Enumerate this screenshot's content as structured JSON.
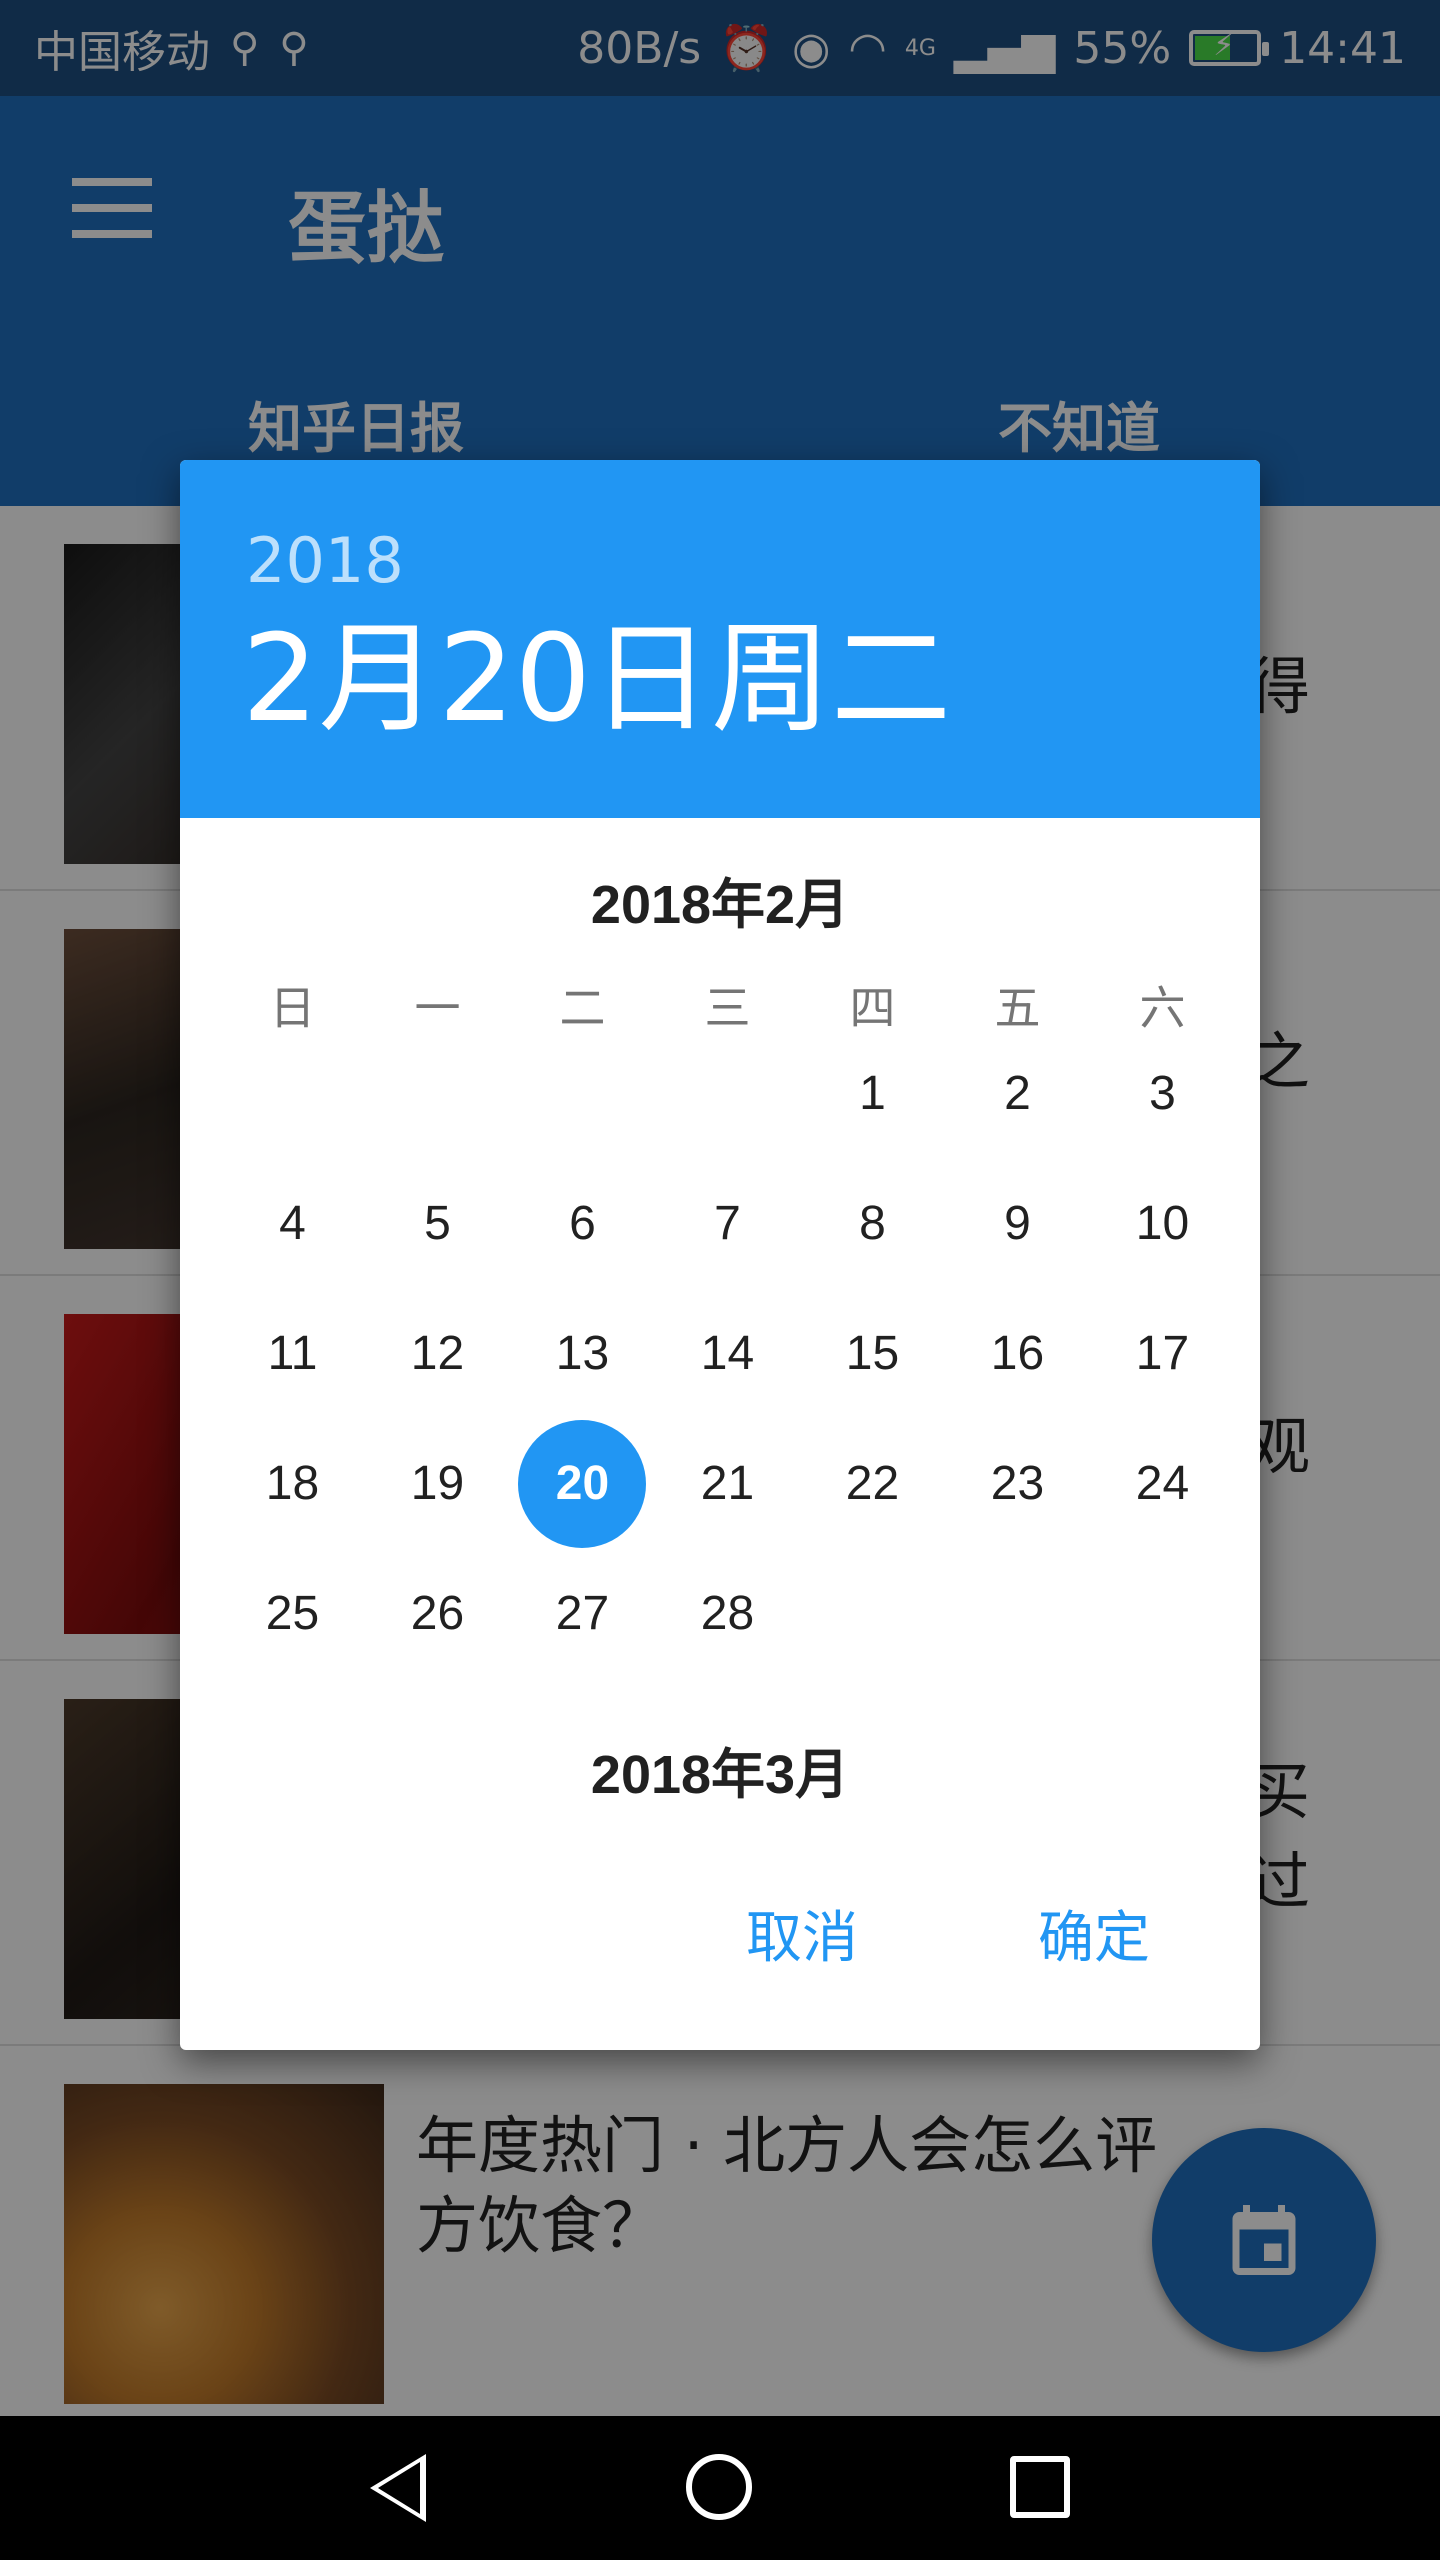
{
  "status_bar": {
    "carrier": "中国移动",
    "net_speed": "80B/s",
    "network": "4G",
    "battery": "55%",
    "time": "14:41"
  },
  "app_bar": {
    "title": "蛋挞",
    "tabs": [
      "知乎日报",
      "不知道"
    ]
  },
  "list": {
    "items": [
      {
        "visible_tail": "得"
      },
      {
        "visible_tail": "之"
      },
      {
        "visible_tail": "观"
      },
      {
        "visible_tail_1": "买",
        "visible_tail_2": "过"
      },
      {
        "title": "年度热门 · 北方人会怎么评方饮食？",
        "line1": "年度热门 · 北方人会怎么评",
        "line2": "方饮食？"
      }
    ]
  },
  "dialog": {
    "header_year": "2018",
    "header_date": "2月20日周二",
    "month_title": "2018年2月",
    "next_month_title": "2018年3月",
    "weekdays": [
      "日",
      "一",
      "二",
      "三",
      "四",
      "五",
      "六"
    ],
    "weeks": [
      [
        "",
        "",
        "",
        "",
        "1",
        "2",
        "3"
      ],
      [
        "4",
        "5",
        "6",
        "7",
        "8",
        "9",
        "10"
      ],
      [
        "11",
        "12",
        "13",
        "14",
        "15",
        "16",
        "17"
      ],
      [
        "18",
        "19",
        "20",
        "21",
        "22",
        "23",
        "24"
      ],
      [
        "25",
        "26",
        "27",
        "28",
        "",
        "",
        ""
      ]
    ],
    "selected_day": "20",
    "cancel_label": "取消",
    "ok_label": "确定"
  },
  "colors": {
    "accent": "#2196f3",
    "primary": "#1f6fbf"
  },
  "icons": {
    "fab": "calendar-icon",
    "menu": "menu-icon"
  }
}
